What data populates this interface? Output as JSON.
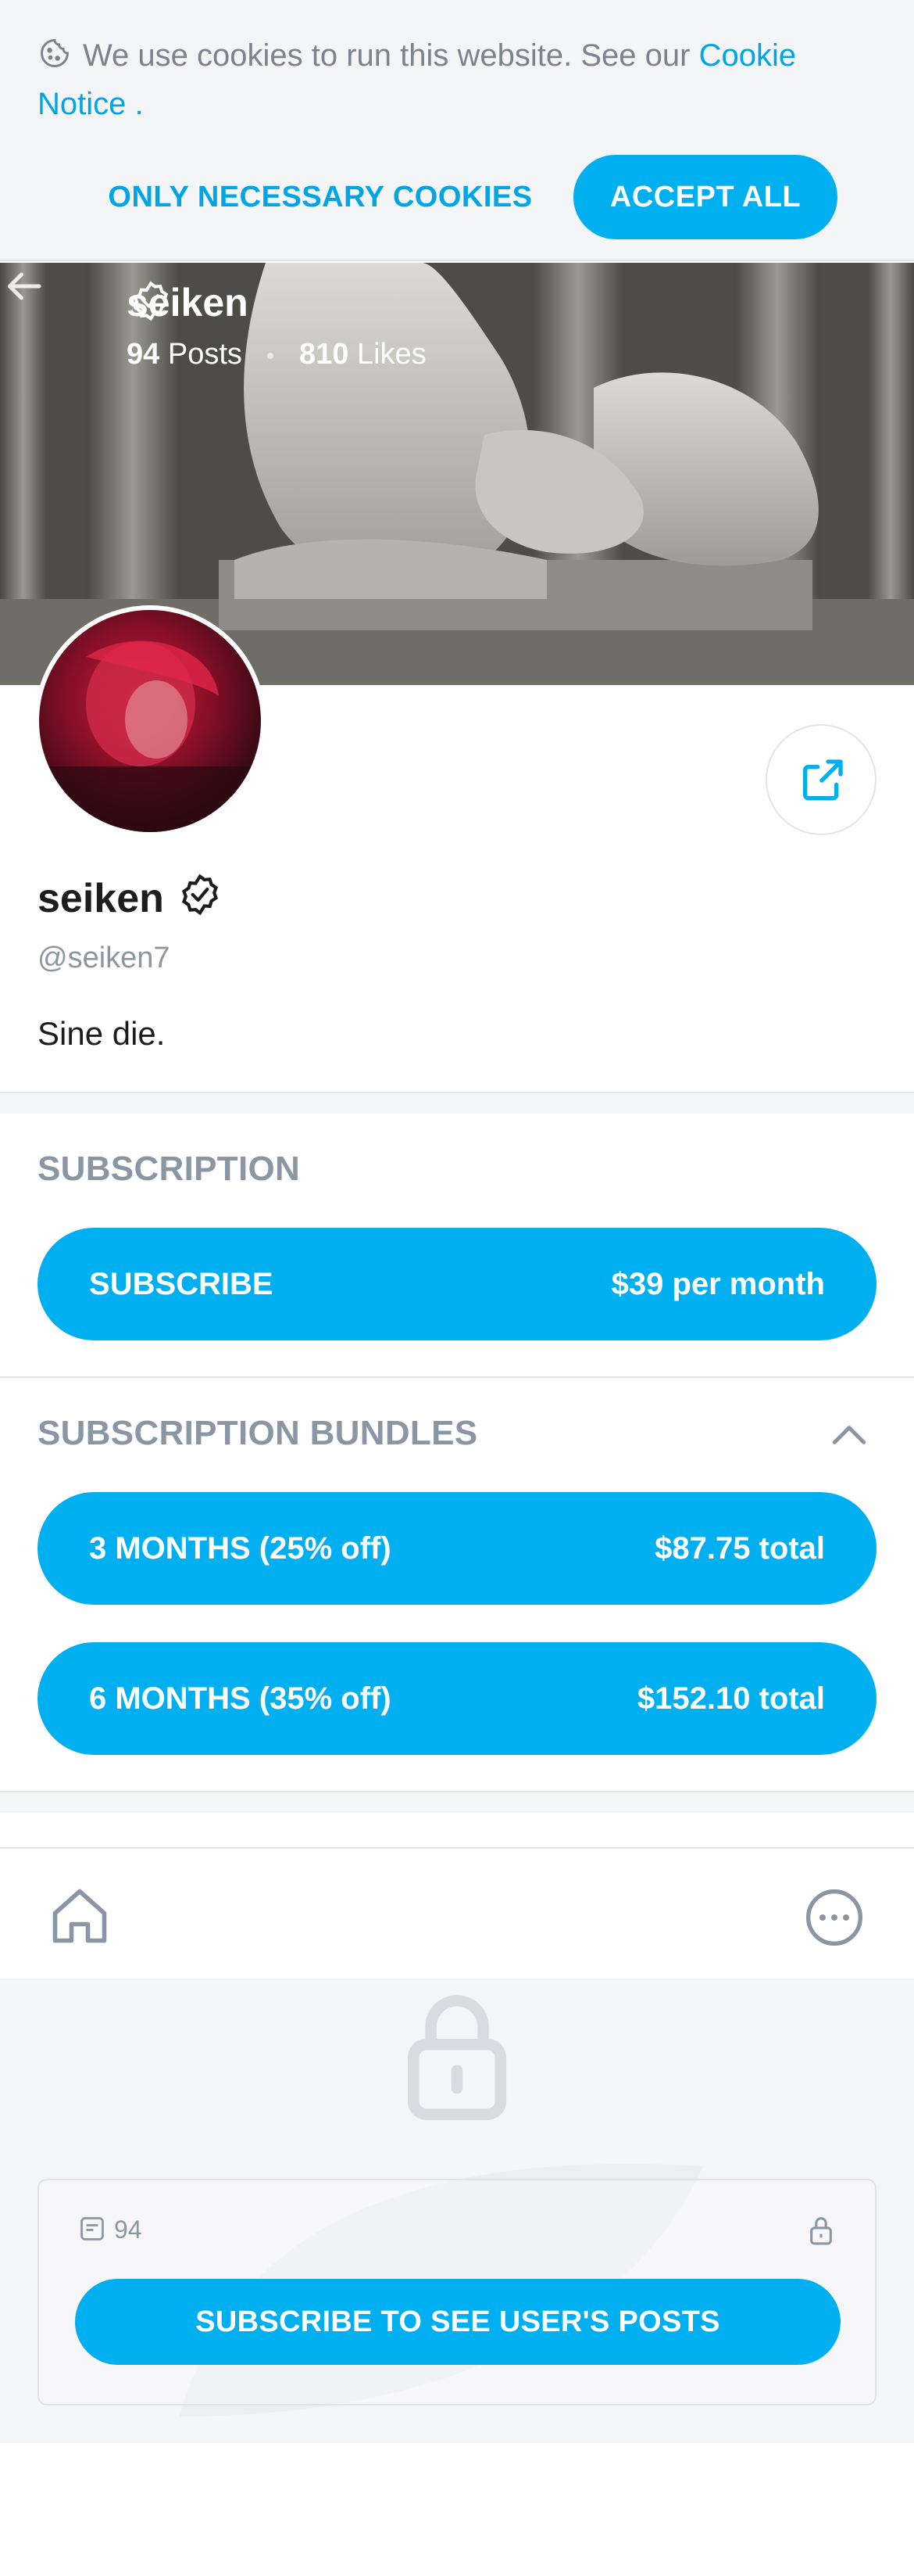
{
  "cookie": {
    "text": "We use cookies to run this website. See our ",
    "link": "Cookie Notice",
    "suffix": " .",
    "necessary_label": "ONLY NECESSARY COOKIES",
    "accept_label": "ACCEPT ALL"
  },
  "header": {
    "name": "seiken",
    "posts_count": "94",
    "posts_label": "Posts",
    "likes_count": "810",
    "likes_label": "Likes"
  },
  "profile": {
    "name": "seiken",
    "handle": "@seiken7",
    "bio": "Sine die."
  },
  "subscription": {
    "title": "SUBSCRIPTION",
    "button_label": "SUBSCRIBE",
    "price": "$39 per month"
  },
  "bundles": {
    "title": "SUBSCRIPTION BUNDLES",
    "items": [
      {
        "label": "3 MONTHS (25% off)",
        "price": "$87.75 total"
      },
      {
        "label": "6 MONTHS (35% off)",
        "price": "$152.10 total"
      }
    ]
  },
  "posts": {
    "count": "94",
    "subscribe_label": "SUBSCRIBE TO SEE USER'S POSTS"
  },
  "colors": {
    "accent": "#00aff0",
    "muted": "#8a96a3",
    "background": "#f4f5f7"
  },
  "icons": [
    "cookie-icon",
    "back-arrow-icon",
    "verified-icon",
    "share-icon",
    "chevron-up-icon",
    "home-icon",
    "more-icon",
    "lock-icon",
    "post-icon"
  ]
}
